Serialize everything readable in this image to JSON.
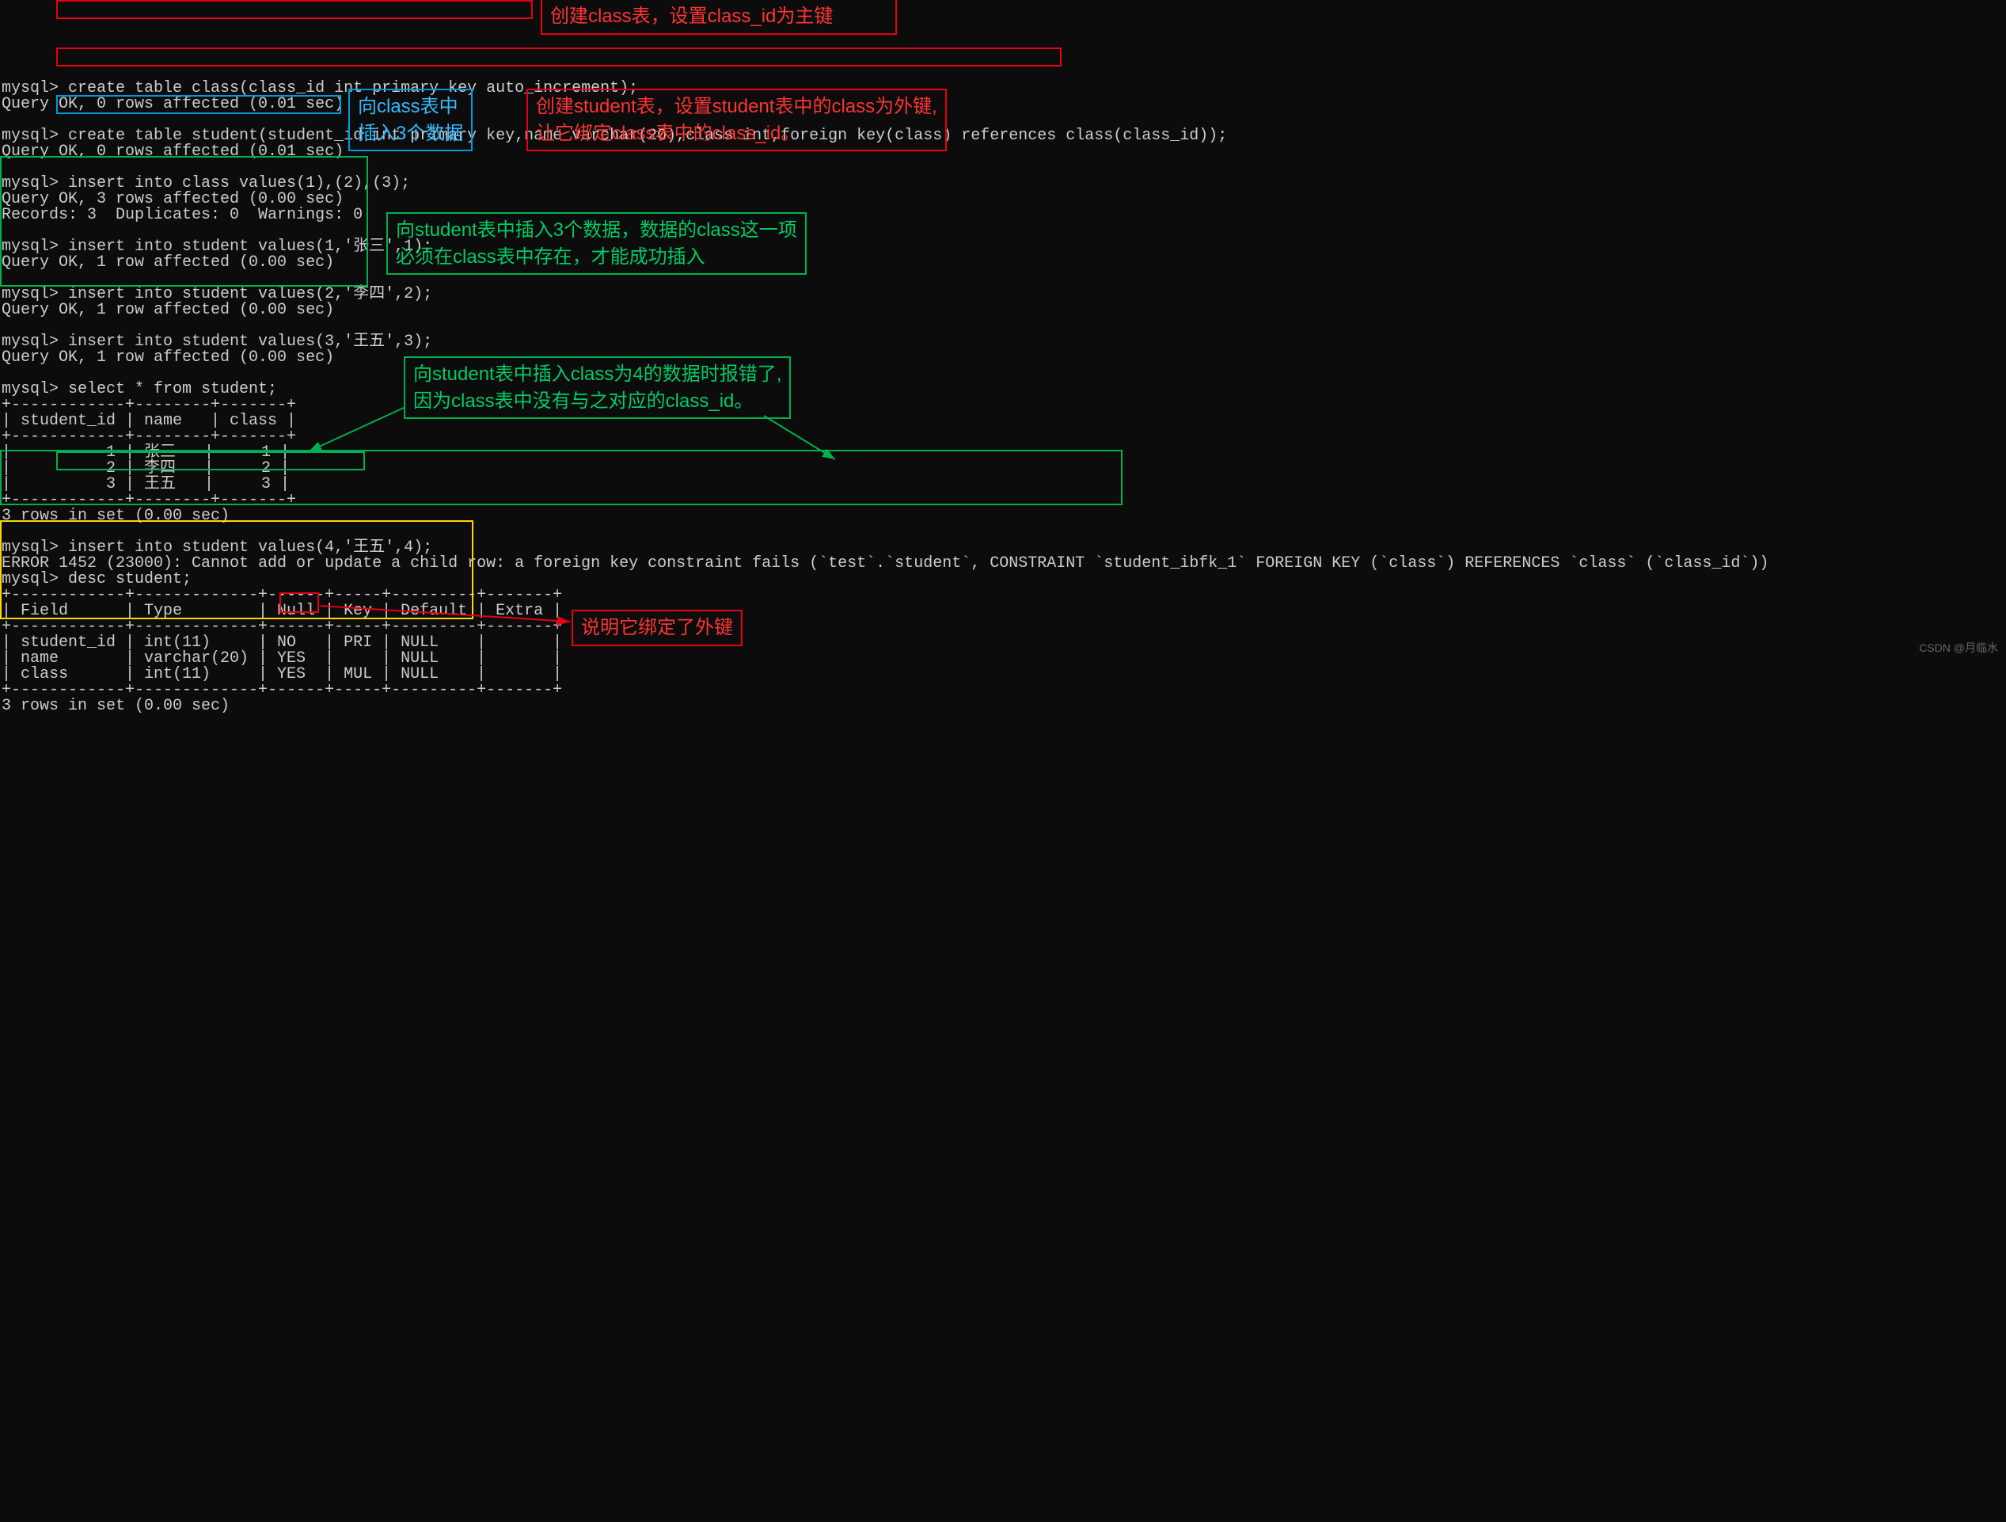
{
  "prompt": "mysql> ",
  "lines": {
    "l1": "create table class(class_id int primary key auto_increment);",
    "l2": "Query OK, 0 rows affected (0.01 sec)",
    "l3": "",
    "l4": "create table student(student_id int primary key,name varchar(20),class int,foreign key(class) references class(class_id));",
    "l5": "Query OK, 0 rows affected (0.01 sec)",
    "l6": "",
    "l7": "insert into class values(1),(2),(3);",
    "l8": "Query OK, 3 rows affected (0.00 sec)",
    "l9": "Records: 3  Duplicates: 0  Warnings: 0",
    "l10": "",
    "l11": "insert into student values(1,'张三',1);",
    "l12": "Query OK, 1 row affected (0.00 sec)",
    "l13": "",
    "l14": "insert into student values(2,'李四',2);",
    "l15": "Query OK, 1 row affected (0.00 sec)",
    "l16": "",
    "l17": "insert into student values(3,'王五',3);",
    "l18": "Query OK, 1 row affected (0.00 sec)",
    "l19": "",
    "l20": "select * from student;",
    "l21": "+------------+--------+-------+",
    "l22": "| student_id | name   | class |",
    "l23": "+------------+--------+-------+",
    "l24": "|          1 | 张三   |     1 |",
    "l25": "|          2 | 李四   |     2 |",
    "l26": "|          3 | 王五   |     3 |",
    "l27": "+------------+--------+-------+",
    "l28": "3 rows in set (0.00 sec)",
    "l29": "",
    "l30": "insert into student values(4,'王五',4);",
    "l31": "ERROR 1452 (23000): Cannot add or update a child row: a foreign key constraint fails (`test`.`student`, CONSTRAINT `student_ibfk_1` FOREIGN KEY (`class`) REFERENCES `class` (`class_id`))",
    "l32": "desc student;",
    "l33": "+------------+-------------+------+-----+---------+-------+",
    "l34": "| Field      | Type        | Null | Key | Default | Extra |",
    "l35": "+------------+-------------+------+-----+---------+-------+",
    "l36": "| student_id | int(11)     | NO   | PRI | NULL    |       |",
    "l37": "| name       | varchar(20) | YES  |     | NULL    |       |",
    "l38": "| class      | int(11)     | YES  | MUL | NULL    |       |",
    "l39": "+------------+-------------+------+-----+---------+-------+",
    "l40": "3 rows in set (0.00 sec)"
  },
  "annotations": {
    "a1": "创建class表，设置class_id为主键",
    "a2": "创建student表，设置student表中的class为外键,\n让它绑定class表中的class_id。",
    "a3": "向class表中\n插入3个数据",
    "a4": "向student表中插入3个数据，数据的class这一项\n必须在class表中存在，才能成功插入",
    "a5": "向student表中插入class为4的数据时报错了,\n因为class表中没有与之对应的class_id。",
    "a6": "说明它绑定了外键"
  },
  "watermark": "CSDN @月临水"
}
